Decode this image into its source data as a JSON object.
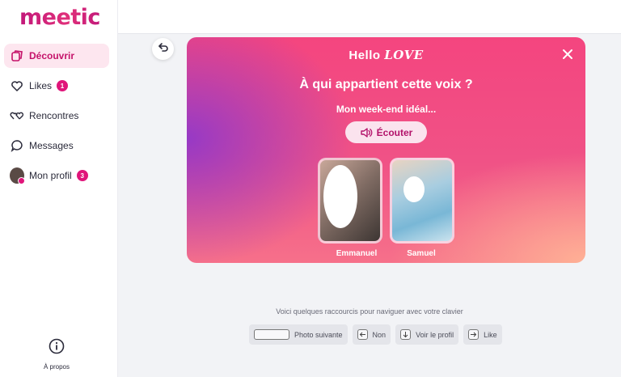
{
  "app": {
    "logo": "meetic"
  },
  "sidebar": {
    "items": [
      {
        "label": "Découvrir",
        "badge": null,
        "active": true
      },
      {
        "label": "Likes",
        "badge": "1"
      },
      {
        "label": "Rencontres",
        "badge": null
      },
      {
        "label": "Messages",
        "badge": null
      },
      {
        "label": "Mon profil",
        "badge": "3"
      }
    ],
    "about_label": "À propos"
  },
  "card": {
    "brand_plain": "Hello",
    "brand_script": "LOVE",
    "question": "À qui appartient cette voix ?",
    "subtitle": "Mon week-end idéal...",
    "listen_label": "Écouter",
    "candidates": [
      {
        "name": "Emmanuel"
      },
      {
        "name": "Samuel"
      }
    ]
  },
  "shortcuts": {
    "title": "Voici quelques raccourcis pour naviguer avec votre clavier",
    "keys": [
      {
        "label": "Photo suivante",
        "key": "space"
      },
      {
        "label": "Non",
        "key": "arrow-left"
      },
      {
        "label": "Voir le profil",
        "key": "arrow-down"
      },
      {
        "label": "Like",
        "key": "arrow-right"
      }
    ]
  },
  "colors": {
    "accent": "#e0157a",
    "active_bg": "#fde6ef"
  }
}
